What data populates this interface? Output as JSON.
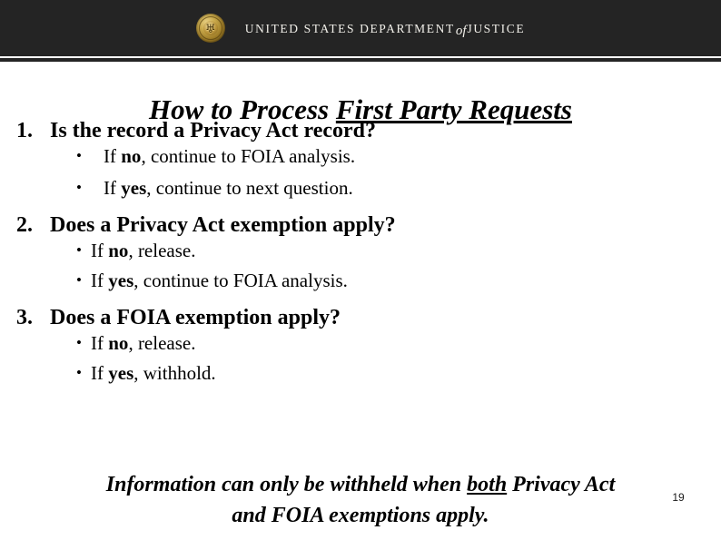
{
  "header": {
    "seal_icon": "doj-seal-icon",
    "eagle_glyph": "♅",
    "wordmark_part1": "UNITED STATES DEPARTMENT",
    "wordmark_of": "of",
    "wordmark_part2": "JUSTICE",
    "background_color": "#242424",
    "text_color": "#f2f0ea",
    "seal_color": "#c9a94b"
  },
  "title": {
    "plain": "How to Process ",
    "underlined": "First Party Requests"
  },
  "questions": [
    {
      "number": "1.",
      "text": "Is the record a Privacy Act record?",
      "bullets": [
        {
          "bullet": "•",
          "prefix": "If ",
          "emphasis": "no",
          "suffix": ", continue to FOIA analysis."
        },
        {
          "bullet": "•",
          "prefix": "If ",
          "emphasis": "yes",
          "suffix": ", continue to next question."
        }
      ]
    },
    {
      "number": "2.",
      "text": "Does a Privacy Act exemption apply?",
      "bullets": [
        {
          "bullet": "•",
          "prefix": "If ",
          "emphasis": "no",
          "suffix": ", release."
        },
        {
          "bullet": "•",
          "prefix": "If ",
          "emphasis": "yes",
          "suffix": ", continue to FOIA analysis."
        }
      ]
    },
    {
      "number": "3.",
      "text": "Does a FOIA exemption apply?",
      "bullets": [
        {
          "bullet": "•",
          "prefix": "If ",
          "emphasis": "no",
          "suffix": ", release."
        },
        {
          "bullet": "•",
          "prefix": "If ",
          "emphasis": "yes",
          "suffix": ", withhold."
        }
      ]
    }
  ],
  "conclusion": {
    "part1": "Information can only be withheld when ",
    "underlined": "both",
    "part2": " Privacy Act and FOIA exemptions apply."
  },
  "page_number": "19"
}
